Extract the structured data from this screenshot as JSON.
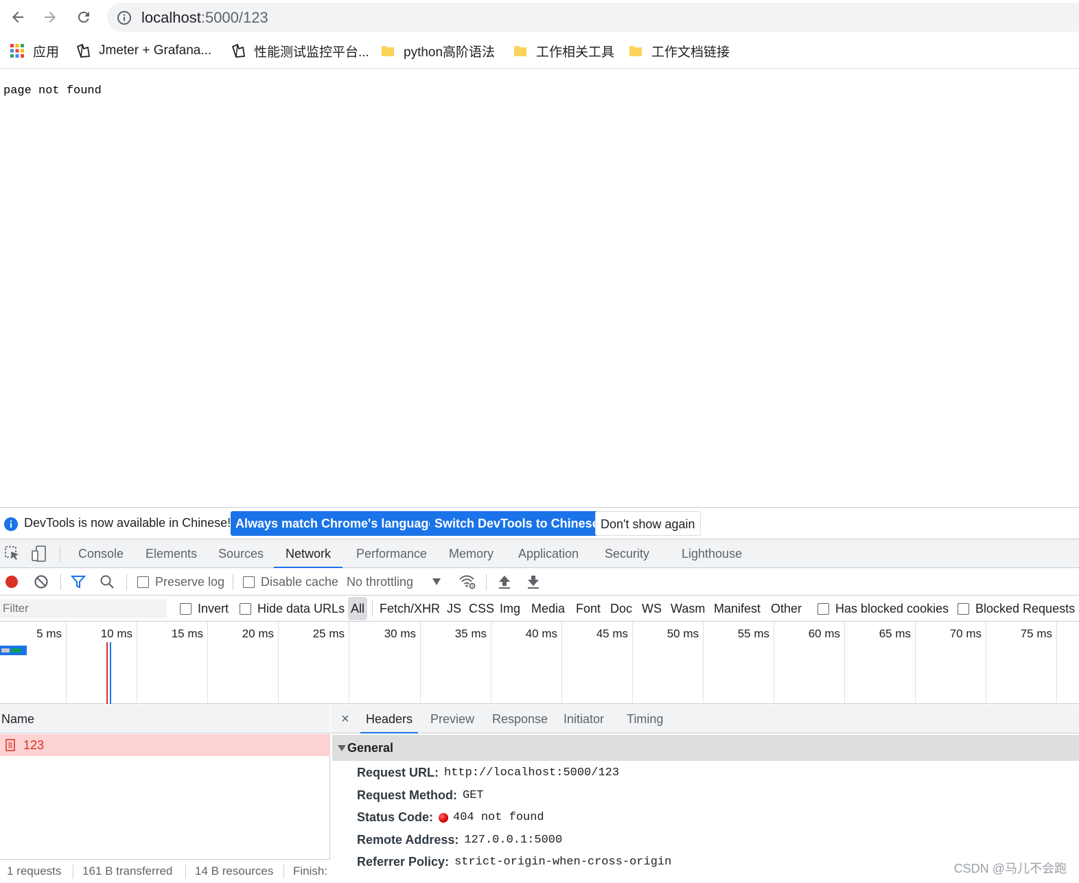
{
  "browser": {
    "url_host": "localhost",
    "url_path": ":5000/123",
    "bookmarks": [
      {
        "label": "应用",
        "icon": "apps-grid-icon"
      },
      {
        "label": "Jmeter + Grafana...",
        "icon": "page-icon"
      },
      {
        "label": "性能测试监控平台...",
        "icon": "page-icon"
      },
      {
        "label": "python高阶语法",
        "icon": "folder-icon"
      },
      {
        "label": "工作相关工具",
        "icon": "folder-icon"
      },
      {
        "label": "工作文档链接",
        "icon": "folder-icon"
      }
    ]
  },
  "page": {
    "body_text": "page not found"
  },
  "devtools": {
    "infobar": {
      "message": "DevTools is now available in Chinese!",
      "btn_match": "Always match Chrome's language",
      "btn_switch": "Switch DevTools to Chinese",
      "btn_dismiss": "Don't show again"
    },
    "tabs": [
      "Console",
      "Elements",
      "Sources",
      "Network",
      "Performance",
      "Memory",
      "Application",
      "Security",
      "Lighthouse"
    ],
    "active_tab": "Network",
    "toolbar": {
      "preserve_log": "Preserve log",
      "disable_cache": "Disable cache",
      "throttling": "No throttling"
    },
    "filterbar": {
      "placeholder": "Filter",
      "invert": "Invert",
      "hide_data_urls": "Hide data URLs",
      "types": [
        "All",
        "Fetch/XHR",
        "JS",
        "CSS",
        "Img",
        "Media",
        "Font",
        "Doc",
        "WS",
        "Wasm",
        "Manifest",
        "Other"
      ],
      "has_blocked_cookies": "Has blocked cookies",
      "blocked_requests": "Blocked Requests"
    },
    "timeline_ticks": [
      "5 ms",
      "10 ms",
      "15 ms",
      "20 ms",
      "25 ms",
      "30 ms",
      "35 ms",
      "40 ms",
      "45 ms",
      "50 ms",
      "55 ms",
      "60 ms",
      "65 ms",
      "70 ms",
      "75 ms"
    ],
    "request_list": {
      "header": "Name",
      "rows": [
        {
          "name": "123"
        }
      ]
    },
    "statusbar": {
      "requests": "1 requests",
      "transferred": "161 B transferred",
      "resources": "14 B resources",
      "finish": "Finish:"
    },
    "detail": {
      "close": "×",
      "tabs": [
        "Headers",
        "Preview",
        "Response",
        "Initiator",
        "Timing"
      ],
      "active_tab": "Headers",
      "section": "General",
      "rows": [
        {
          "key": "Request URL:",
          "value": "http://localhost:5000/123"
        },
        {
          "key": "Request Method:",
          "value": "GET"
        },
        {
          "key": "Status Code:",
          "value": "404 not found"
        },
        {
          "key": "Remote Address:",
          "value": "127.0.0.1:5000"
        },
        {
          "key": "Referrer Policy:",
          "value": "strict-origin-when-cross-origin"
        }
      ]
    }
  },
  "watermark": "CSDN @马儿不会跑",
  "colors": {
    "accent": "#1a73e8",
    "error_row": "#fcd2d2",
    "error_text": "#d93025"
  }
}
